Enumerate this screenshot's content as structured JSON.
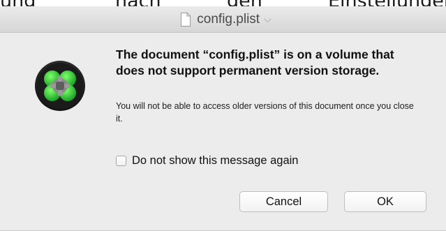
{
  "background": {
    "words": [
      "und",
      "nach",
      "den",
      "Einstellungen"
    ]
  },
  "titlebar": {
    "title": "config.plist",
    "chevron": "⌵",
    "doc_icon": "document-icon"
  },
  "dialog": {
    "app_icon": "clover-app-icon",
    "headline": "The document “config.plist” is on a volume that does not support permanent version storage.",
    "body": "You will not be able to access older versions of this document once you close it.",
    "checkbox_label": "Do not show this message again",
    "checkbox_checked": false,
    "cancel_label": "Cancel",
    "ok_label": "OK"
  },
  "colors": {
    "sheet_bg": "#ececec",
    "icon_green": "#2bbf3a"
  }
}
